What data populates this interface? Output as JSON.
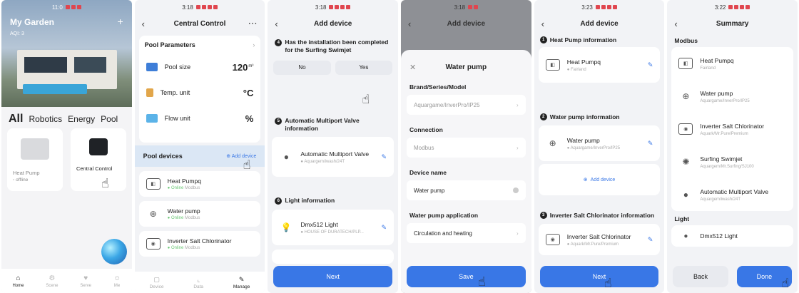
{
  "screen1": {
    "status_time": "11:0",
    "garden_title": "My Garden",
    "weather": "AQI: 3",
    "categories": [
      "All",
      "Robotics",
      "Energy",
      "Pool"
    ],
    "card_left": {
      "name": "Heat Pump",
      "status": "offline"
    },
    "card_right": {
      "name": "Central Control"
    },
    "tabs": [
      "Home",
      "Scene",
      "Serve",
      "Me"
    ]
  },
  "screen2": {
    "status_time": "3:18",
    "title": "Central Control",
    "more": "···",
    "params_title": "Pool Parameters",
    "params": [
      {
        "label": "Pool size",
        "value": "120",
        "unit": "m³"
      },
      {
        "label": "Temp. unit",
        "value": "°C",
        "unit": ""
      },
      {
        "label": "Flow unit",
        "value": "%",
        "unit": ""
      }
    ],
    "devices_title": "Pool devices",
    "add_device": "Add device",
    "devices": [
      {
        "name": "Heat Pumpq",
        "status": "Online",
        "conn": "Modbus"
      },
      {
        "name": "Water pump",
        "status": "Online",
        "conn": "Modbus"
      },
      {
        "name": "Inverter Salt Chlorinator",
        "status": "Online",
        "conn": "Modbus"
      }
    ],
    "nav": [
      "Device",
      "Data",
      "Manage"
    ]
  },
  "screen3": {
    "status_time": "3:18",
    "title": "Add device",
    "q4_num": "4",
    "q4": "Has the installation been completed for the Surfing Swimjet",
    "no": "No",
    "yes": "Yes",
    "q5_num": "5",
    "q5": "Automatic Multiport Valve information",
    "valve_name": "Automatic Multiport Valve",
    "valve_sub": "Aquargem/iwash/24T",
    "q6_num": "6",
    "q6": "Light information",
    "light_name": "Dmx512 Light",
    "light_sub": "HOUSE OF DURATECH/PLP...",
    "next": "Next"
  },
  "screen4": {
    "status_time": "3:18",
    "title": "Add device",
    "sheet_title": "Water pump",
    "brand_label": "Brand/Series/Model",
    "brand_value": "Aquargame/InverPro/IP25",
    "connection_label": "Connection",
    "connection_value": "Modbus",
    "name_label": "Device name",
    "name_value": "Water pump",
    "app_label": "Water pump application",
    "app_value": "Circulation and heating",
    "save": "Save"
  },
  "screen5": {
    "status_time": "3:23",
    "title": "Add device",
    "s1_num": "1",
    "s1": "Heat Pump information",
    "hp_name": "Heat Pumpq",
    "hp_sub": "Fairland",
    "s2_num": "2",
    "s2": "Water pump information",
    "wp_name": "Water pump",
    "wp_sub": "Aquargame/InverPro/IP25",
    "add_device": "Add device",
    "s3_num": "3",
    "s3": "Inverter Salt Chlorinator information",
    "isc_name": "Inverter Salt Chlorinator",
    "isc_sub": "Aquark/Mr.Pure/Premium",
    "next": "Next"
  },
  "screen6": {
    "status_time": "3:22",
    "title": "Summary",
    "modbus_label": "Modbus",
    "items": [
      {
        "name": "Heat Pumpq",
        "sub": "Fairland"
      },
      {
        "name": "Water pump",
        "sub": "Aquargame/InverPro/IP25"
      },
      {
        "name": "Inverter Salt Chlorinator",
        "sub": "Aquark/Mr.Pure/Premium"
      },
      {
        "name": "Surfing Swimjet",
        "sub": "Aquargem/Mr.Surfing/SJ100"
      },
      {
        "name": "Automatic Multiport Valve",
        "sub": "Aquargem/iwash/24T"
      }
    ],
    "light_label": "Light",
    "light_item": "Dmx512 Light",
    "back": "Back",
    "done": "Done"
  },
  "colors": {
    "accent": "#3977e6",
    "online": "#6cc776"
  }
}
